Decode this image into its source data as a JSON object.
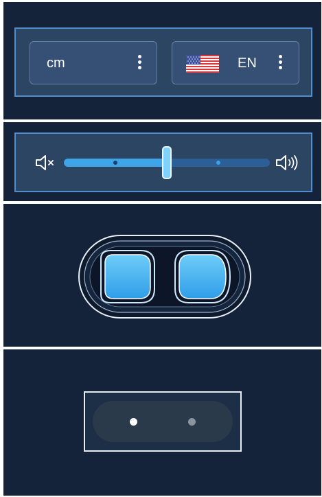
{
  "unit_dropdown": {
    "value": "cm",
    "icon": "more-vert-icon"
  },
  "language_dropdown": {
    "value": "EN",
    "flag": "us-flag-icon",
    "icon": "more-vert-icon"
  },
  "volume_slider": {
    "level": 0.5,
    "tick_marks": [
      0.25,
      0.75
    ],
    "min_icon": "volume-mute-icon",
    "max_icon": "volume-up-icon"
  },
  "toggle_buttons": {
    "items": [
      "left",
      "right"
    ],
    "active": [
      "left"
    ]
  },
  "page_indicator": {
    "count": 2,
    "current": 1
  },
  "colors": {
    "background": "#14223a",
    "panel_outline": "#4f8fcf",
    "accent": "#3ea5e8",
    "active_button": "#4fb7f2",
    "dot_active": "#ffffff",
    "dot_inactive": "#8a949f"
  }
}
